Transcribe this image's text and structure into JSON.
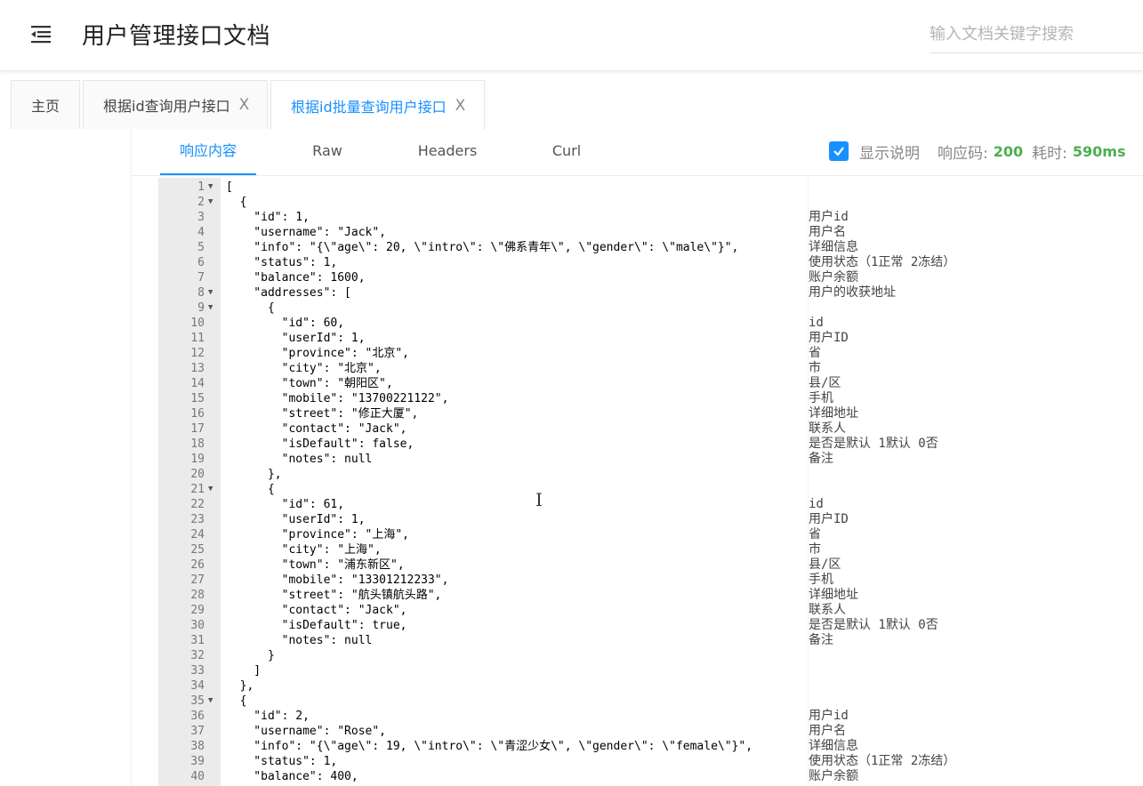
{
  "header": {
    "title": "用户管理接口文档",
    "search_placeholder": "输入文档关键字搜索"
  },
  "tabs": [
    {
      "label": "主页",
      "closable": false,
      "active": false
    },
    {
      "label": "根据id查询用户接口",
      "closable": true,
      "active": false
    },
    {
      "label": "根据id批量查询用户接口",
      "closable": true,
      "active": true
    }
  ],
  "tab_close_glyph": "X",
  "subtabs": [
    {
      "label": "响应内容",
      "active": true
    },
    {
      "label": "Raw",
      "active": false
    },
    {
      "label": "Headers",
      "active": false
    },
    {
      "label": "Curl",
      "active": false
    }
  ],
  "response_meta": {
    "show_desc_label": "显示说明",
    "show_desc_checked": true,
    "code_label": "响应码:",
    "code_value": "200",
    "time_label": "耗时:",
    "time_value": "590ms"
  },
  "colors": {
    "accent": "#1890ff",
    "success": "#4caf50"
  },
  "code_lines": [
    {
      "n": "1",
      "fold": true,
      "code": "[",
      "desc": ""
    },
    {
      "n": "2",
      "fold": true,
      "code": "  {",
      "desc": ""
    },
    {
      "n": "3",
      "fold": false,
      "code": "    \"id\": 1,",
      "desc": "用户id"
    },
    {
      "n": "4",
      "fold": false,
      "code": "    \"username\": \"Jack\",",
      "desc": "用户名"
    },
    {
      "n": "5",
      "fold": false,
      "code": "    \"info\": \"{\\\"age\\\": 20, \\\"intro\\\": \\\"佛系青年\\\", \\\"gender\\\": \\\"male\\\"}\",",
      "desc": "详细信息"
    },
    {
      "n": "6",
      "fold": false,
      "code": "    \"status\": 1,",
      "desc": "使用状态（1正常 2冻结）"
    },
    {
      "n": "7",
      "fold": false,
      "code": "    \"balance\": 1600,",
      "desc": "账户余额"
    },
    {
      "n": "8",
      "fold": true,
      "code": "    \"addresses\": [",
      "desc": "用户的收获地址"
    },
    {
      "n": "9",
      "fold": true,
      "code": "      {",
      "desc": ""
    },
    {
      "n": "10",
      "fold": false,
      "code": "        \"id\": 60,",
      "desc": "id"
    },
    {
      "n": "11",
      "fold": false,
      "code": "        \"userId\": 1,",
      "desc": "用户ID"
    },
    {
      "n": "12",
      "fold": false,
      "code": "        \"province\": \"北京\",",
      "desc": "省"
    },
    {
      "n": "13",
      "fold": false,
      "code": "        \"city\": \"北京\",",
      "desc": "市"
    },
    {
      "n": "14",
      "fold": false,
      "code": "        \"town\": \"朝阳区\",",
      "desc": "县/区"
    },
    {
      "n": "15",
      "fold": false,
      "code": "        \"mobile\": \"13700221122\",",
      "desc": "手机"
    },
    {
      "n": "16",
      "fold": false,
      "code": "        \"street\": \"修正大厦\",",
      "desc": "详细地址"
    },
    {
      "n": "17",
      "fold": false,
      "code": "        \"contact\": \"Jack\",",
      "desc": "联系人"
    },
    {
      "n": "18",
      "fold": false,
      "code": "        \"isDefault\": false,",
      "desc": "是否是默认 1默认 0否"
    },
    {
      "n": "19",
      "fold": false,
      "code": "        \"notes\": null",
      "desc": "备注"
    },
    {
      "n": "20",
      "fold": false,
      "code": "      },",
      "desc": ""
    },
    {
      "n": "21",
      "fold": true,
      "code": "      {",
      "desc": ""
    },
    {
      "n": "22",
      "fold": false,
      "code": "        \"id\": 61,",
      "desc": "id"
    },
    {
      "n": "23",
      "fold": false,
      "code": "        \"userId\": 1,",
      "desc": "用户ID"
    },
    {
      "n": "24",
      "fold": false,
      "code": "        \"province\": \"上海\",",
      "desc": "省"
    },
    {
      "n": "25",
      "fold": false,
      "code": "        \"city\": \"上海\",",
      "desc": "市"
    },
    {
      "n": "26",
      "fold": false,
      "code": "        \"town\": \"浦东新区\",",
      "desc": "县/区"
    },
    {
      "n": "27",
      "fold": false,
      "code": "        \"mobile\": \"13301212233\",",
      "desc": "手机"
    },
    {
      "n": "28",
      "fold": false,
      "code": "        \"street\": \"航头镇航头路\",",
      "desc": "详细地址"
    },
    {
      "n": "29",
      "fold": false,
      "code": "        \"contact\": \"Jack\",",
      "desc": "联系人"
    },
    {
      "n": "30",
      "fold": false,
      "code": "        \"isDefault\": true,",
      "desc": "是否是默认 1默认 0否"
    },
    {
      "n": "31",
      "fold": false,
      "code": "        \"notes\": null",
      "desc": "备注"
    },
    {
      "n": "32",
      "fold": false,
      "code": "      }",
      "desc": ""
    },
    {
      "n": "33",
      "fold": false,
      "code": "    ]",
      "desc": ""
    },
    {
      "n": "34",
      "fold": false,
      "code": "  },",
      "desc": ""
    },
    {
      "n": "35",
      "fold": true,
      "code": "  {",
      "desc": ""
    },
    {
      "n": "36",
      "fold": false,
      "code": "    \"id\": 2,",
      "desc": "用户id"
    },
    {
      "n": "37",
      "fold": false,
      "code": "    \"username\": \"Rose\",",
      "desc": "用户名"
    },
    {
      "n": "38",
      "fold": false,
      "code": "    \"info\": \"{\\\"age\\\": 19, \\\"intro\\\": \\\"青涩少女\\\", \\\"gender\\\": \\\"female\\\"}\",",
      "desc": "详细信息"
    },
    {
      "n": "39",
      "fold": false,
      "code": "    \"status\": 1,",
      "desc": "使用状态（1正常 2冻结）"
    },
    {
      "n": "40",
      "fold": false,
      "code": "    \"balance\": 400,",
      "desc": "账户余额"
    }
  ]
}
